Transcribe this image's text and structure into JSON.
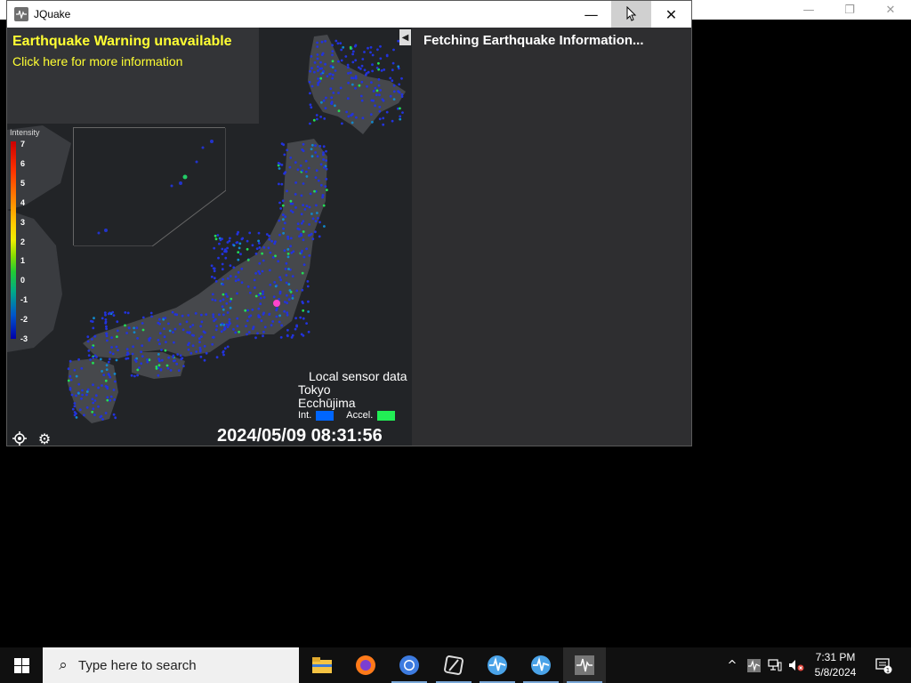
{
  "background_window": {
    "controls": [
      "—",
      "❐",
      "✕"
    ]
  },
  "window": {
    "title": "JQuake",
    "controls": {
      "minimize": "—",
      "maximize": "",
      "close": "✕"
    }
  },
  "warning": {
    "title": "Earthquake Warning unavailable",
    "link": "Click here for more information",
    "color": "#ffff33"
  },
  "legend": {
    "title": "Intensity",
    "labels": [
      "7",
      "6",
      "5",
      "4",
      "3",
      "2",
      "1",
      "0",
      "-1",
      "-2",
      "-3"
    ]
  },
  "sensor": {
    "title": "Local sensor data",
    "location1": "Tokyo",
    "location2": "Ecchūjima",
    "int_label": "Int.",
    "accel_label": "Accel.",
    "int_color": "#0066ff",
    "accel_color": "#22ee55"
  },
  "timestamp": "2024/05/09 08:31:56",
  "info_panel": {
    "status": "Fetching Earthquake Information..."
  },
  "taskbar": {
    "search_placeholder": "Type here to search",
    "apps": [
      "file-explorer",
      "firefox",
      "chrome",
      "app-4",
      "app-5",
      "app-6",
      "jquake"
    ],
    "clock_time": "7:31 PM",
    "clock_date": "5/8/2024",
    "notification_count": "1"
  }
}
